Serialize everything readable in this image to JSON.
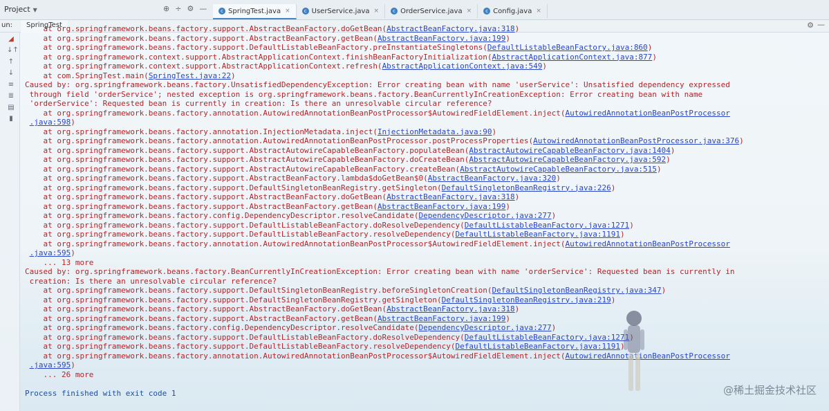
{
  "topbar": {
    "project_label": "Project",
    "tabs": [
      {
        "label": "SpringTest.java",
        "active": true
      },
      {
        "label": "UserService.java",
        "active": false
      },
      {
        "label": "OrderService.java",
        "active": false
      },
      {
        "label": "Config.java",
        "active": false
      }
    ]
  },
  "runbar": {
    "label": "un:",
    "tab": "SpringTest"
  },
  "console": {
    "lines": [
      {
        "k": "err",
        "t": "    at org.springframework.beans.factory.support.AbstractBeanFactory.doGetBean(",
        "l": "AbstractBeanFactory.java:318",
        "a": ")"
      },
      {
        "k": "err",
        "t": "    at org.springframework.beans.factory.support.AbstractBeanFactory.getBean(",
        "l": "AbstractBeanFactory.java:199",
        "a": ")"
      },
      {
        "k": "err",
        "t": "    at org.springframework.beans.factory.support.DefaultListableBeanFactory.preInstantiateSingletons(",
        "l": "DefaultListableBeanFactory.java:860",
        "a": ")"
      },
      {
        "k": "err",
        "t": "    at org.springframework.context.support.AbstractApplicationContext.finishBeanFactoryInitialization(",
        "l": "AbstractApplicationContext.java:877",
        "a": ")"
      },
      {
        "k": "err",
        "t": "    at org.springframework.context.support.AbstractApplicationContext.refresh(",
        "l": "AbstractApplicationContext.java:549",
        "a": ")"
      },
      {
        "k": "err",
        "t": "    at com.SpringTest.main(",
        "l": "SpringTest.java:22",
        "a": ")"
      },
      {
        "k": "err",
        "t": "Caused by: org.springframework.beans.factory.UnsatisfiedDependencyException: Error creating bean with name 'userService': Unsatisfied dependency expressed",
        "l": "",
        "a": ""
      },
      {
        "k": "err",
        "t": " through field 'orderService'; nested exception is org.springframework.beans.factory.BeanCurrentlyInCreationException: Error creating bean with name",
        "l": "",
        "a": ""
      },
      {
        "k": "err",
        "t": " 'orderService': Requested bean is currently in creation: Is there an unresolvable circular reference?",
        "l": "",
        "a": ""
      },
      {
        "k": "err",
        "t": "    at org.springframework.beans.factory.annotation.AutowiredAnnotationBeanPostProcessor$AutowiredFieldElement.inject(",
        "l": "AutowiredAnnotationBeanPostProcessor",
        "a": ""
      },
      {
        "k": "err",
        "t": " ",
        "l": ".java:598",
        "a": ")"
      },
      {
        "k": "err",
        "t": "    at org.springframework.beans.factory.annotation.InjectionMetadata.inject(",
        "l": "InjectionMetadata.java:90",
        "a": ")"
      },
      {
        "k": "err",
        "t": "    at org.springframework.beans.factory.annotation.AutowiredAnnotationBeanPostProcessor.postProcessProperties(",
        "l": "AutowiredAnnotationBeanPostProcessor.java:376",
        "a": ")"
      },
      {
        "k": "err",
        "t": "    at org.springframework.beans.factory.support.AbstractAutowireCapableBeanFactory.populateBean(",
        "l": "AbstractAutowireCapableBeanFactory.java:1404",
        "a": ")"
      },
      {
        "k": "err",
        "t": "    at org.springframework.beans.factory.support.AbstractAutowireCapableBeanFactory.doCreateBean(",
        "l": "AbstractAutowireCapableBeanFactory.java:592",
        "a": ")"
      },
      {
        "k": "err",
        "t": "    at org.springframework.beans.factory.support.AbstractAutowireCapableBeanFactory.createBean(",
        "l": "AbstractAutowireCapableBeanFactory.java:515",
        "a": ")"
      },
      {
        "k": "err",
        "t": "    at org.springframework.beans.factory.support.AbstractBeanFactory.lambda$doGetBean$0(",
        "l": "AbstractBeanFactory.java:320",
        "a": ")"
      },
      {
        "k": "err",
        "t": "    at org.springframework.beans.factory.support.DefaultSingletonBeanRegistry.getSingleton(",
        "l": "DefaultSingletonBeanRegistry.java:226",
        "a": ")"
      },
      {
        "k": "err",
        "t": "    at org.springframework.beans.factory.support.AbstractBeanFactory.doGetBean(",
        "l": "AbstractBeanFactory.java:318",
        "a": ")"
      },
      {
        "k": "err",
        "t": "    at org.springframework.beans.factory.support.AbstractBeanFactory.getBean(",
        "l": "AbstractBeanFactory.java:199",
        "a": ")"
      },
      {
        "k": "err",
        "t": "    at org.springframework.beans.factory.config.DependencyDescriptor.resolveCandidate(",
        "l": "DependencyDescriptor.java:277",
        "a": ")"
      },
      {
        "k": "err",
        "t": "    at org.springframework.beans.factory.support.DefaultListableBeanFactory.doResolveDependency(",
        "l": "DefaultListableBeanFactory.java:1271",
        "a": ")"
      },
      {
        "k": "err",
        "t": "    at org.springframework.beans.factory.support.DefaultListableBeanFactory.resolveDependency(",
        "l": "DefaultListableBeanFactory.java:1191",
        "a": ")"
      },
      {
        "k": "err",
        "t": "    at org.springframework.beans.factory.annotation.AutowiredAnnotationBeanPostProcessor$AutowiredFieldElement.inject(",
        "l": "AutowiredAnnotationBeanPostProcessor",
        "a": ""
      },
      {
        "k": "err",
        "t": " ",
        "l": ".java:595",
        "a": ")"
      },
      {
        "k": "err",
        "t": "    ... 13 more",
        "l": "",
        "a": ""
      },
      {
        "k": "err",
        "t": "Caused by: org.springframework.beans.factory.BeanCurrentlyInCreationException: Error creating bean with name 'orderService': Requested bean is currently in",
        "l": "",
        "a": ""
      },
      {
        "k": "err",
        "t": " creation: Is there an unresolvable circular reference?",
        "l": "",
        "a": ""
      },
      {
        "k": "err",
        "t": "    at org.springframework.beans.factory.support.DefaultSingletonBeanRegistry.beforeSingletonCreation(",
        "l": "DefaultSingletonBeanRegistry.java:347",
        "a": ")"
      },
      {
        "k": "err",
        "t": "    at org.springframework.beans.factory.support.DefaultSingletonBeanRegistry.getSingleton(",
        "l": "DefaultSingletonBeanRegistry.java:219",
        "a": ")"
      },
      {
        "k": "err",
        "t": "    at org.springframework.beans.factory.support.AbstractBeanFactory.doGetBean(",
        "l": "AbstractBeanFactory.java:318",
        "a": ")"
      },
      {
        "k": "err",
        "t": "    at org.springframework.beans.factory.support.AbstractBeanFactory.getBean(",
        "l": "AbstractBeanFactory.java:199",
        "a": ")"
      },
      {
        "k": "err",
        "t": "    at org.springframework.beans.factory.config.DependencyDescriptor.resolveCandidate(",
        "l": "DependencyDescriptor.java:277",
        "a": ")"
      },
      {
        "k": "err",
        "t": "    at org.springframework.beans.factory.support.DefaultListableBeanFactory.doResolveDependency(",
        "l": "DefaultListableBeanFactory.java:1271",
        "a": ")"
      },
      {
        "k": "err",
        "t": "    at org.springframework.beans.factory.support.DefaultListableBeanFactory.resolveDependency(",
        "l": "DefaultListableBeanFactory.java:1191",
        "a": ")"
      },
      {
        "k": "err",
        "t": "    at org.springframework.beans.factory.annotation.AutowiredAnnotationBeanPostProcessor$AutowiredFieldElement.inject(",
        "l": "AutowiredAnnotationBeanPostProcessor",
        "a": ""
      },
      {
        "k": "err",
        "t": " ",
        "l": ".java:595",
        "a": ")"
      },
      {
        "k": "err",
        "t": "    ... 26 more",
        "l": "",
        "a": ""
      },
      {
        "k": "blank",
        "t": "",
        "l": "",
        "a": ""
      },
      {
        "k": "ok",
        "t": "Process finished with exit code 1",
        "l": "",
        "a": ""
      }
    ]
  },
  "watermark": "@稀土掘金技术社区",
  "colors": {
    "error_text": "#b0262a",
    "link": "#2a45c8",
    "process_text": "#1c4f9c"
  }
}
